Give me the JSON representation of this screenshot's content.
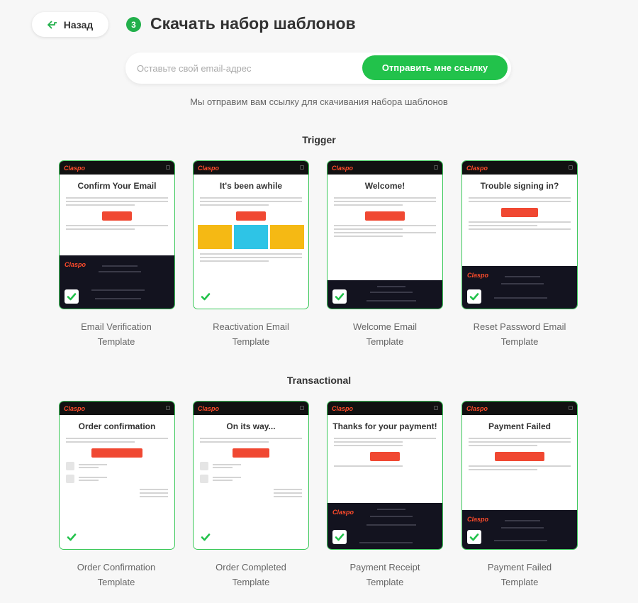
{
  "header": {
    "back_label": "Назад",
    "step_number": "3",
    "title": "Скачать набор шаблонов"
  },
  "email_form": {
    "placeholder": "Оставьте свой email-адрес",
    "submit_label": "Отправить мне ссылку",
    "hint": "Мы отправим вам ссылку для скачивания набора шаблонов"
  },
  "brand": {
    "logo_text": "Claspo",
    "accent_color": "#22c24b",
    "card_button_color": "#f04832"
  },
  "sections": [
    {
      "title": "Trigger",
      "templates": [
        {
          "preview_title": "Confirm Your Email",
          "caption_line1": "Email Verification",
          "caption_line2": "Template",
          "selected": true
        },
        {
          "preview_title": "It's been awhile",
          "caption_line1": "Reactivation Email",
          "caption_line2": "Template",
          "selected": true
        },
        {
          "preview_title": "Welcome!",
          "caption_line1": "Welcome Email",
          "caption_line2": "Template",
          "selected": true
        },
        {
          "preview_title": "Trouble signing in?",
          "caption_line1": "Reset Password Email",
          "caption_line2": "Template",
          "selected": true
        }
      ]
    },
    {
      "title": "Transactional",
      "templates": [
        {
          "preview_title": "Order confirmation",
          "caption_line1": "Order Confirmation",
          "caption_line2": "Template",
          "selected": true
        },
        {
          "preview_title": "On its way...",
          "caption_line1": "Order Completed",
          "caption_line2": "Template",
          "selected": true
        },
        {
          "preview_title": "Thanks for your payment!",
          "caption_line1": "Payment Receipt",
          "caption_line2": "Template",
          "selected": true
        },
        {
          "preview_title": "Payment Failed",
          "caption_line1": "Payment Failed",
          "caption_line2": "Template",
          "selected": true
        }
      ]
    }
  ]
}
